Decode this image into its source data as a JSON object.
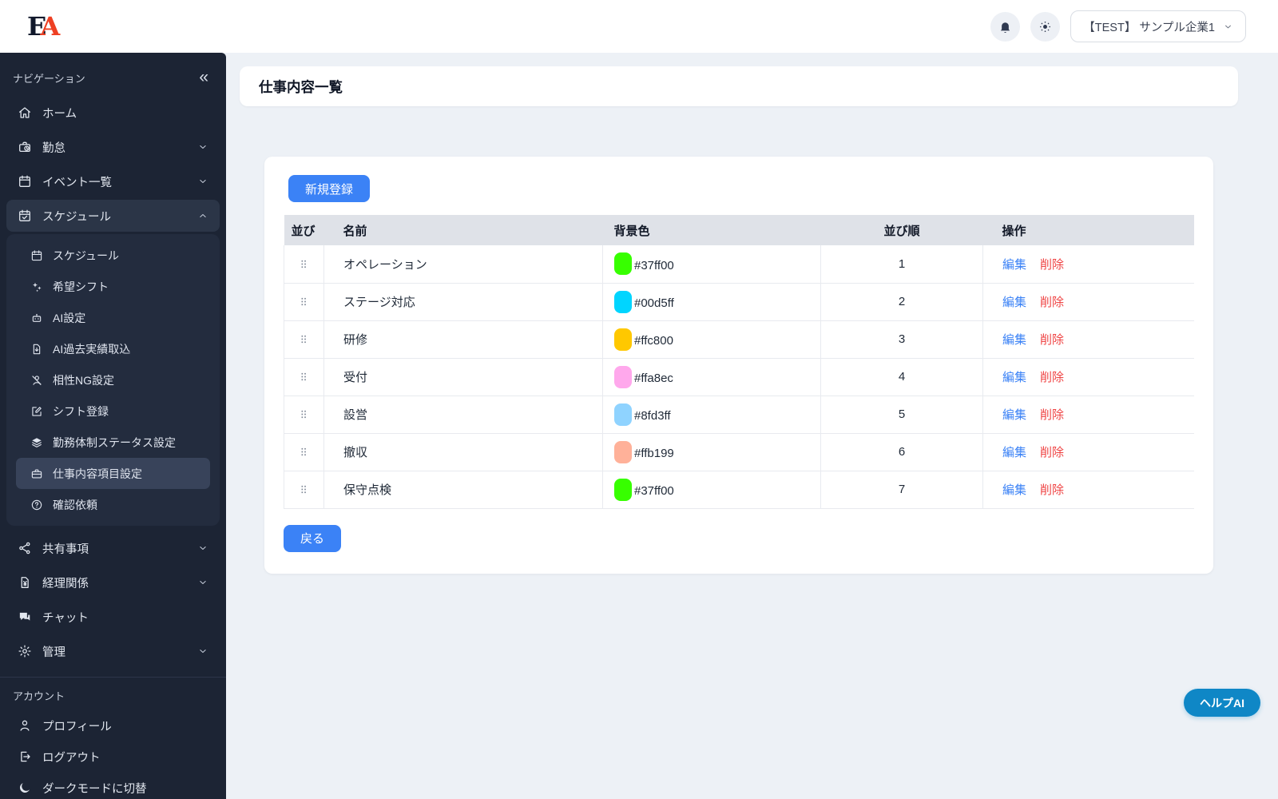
{
  "topbar": {
    "logo_text_e": "E",
    "logo_text_a": "A",
    "company_selector": "【TEST】 サンプル企業1"
  },
  "sidebar": {
    "header": "ナビゲーション",
    "collapse_glyph": "«",
    "items": [
      {
        "label": "ホーム",
        "icon": "home"
      },
      {
        "label": "勤怠",
        "icon": "briefcase-clock",
        "chevron": "down"
      },
      {
        "label": "イベント一覧",
        "icon": "calendar",
        "chevron": "down"
      },
      {
        "label": "スケジュール",
        "icon": "calendar-check",
        "chevron": "up",
        "active": true,
        "children": [
          {
            "label": "スケジュール",
            "icon": "calendar"
          },
          {
            "label": "希望シフト",
            "icon": "wand"
          },
          {
            "label": "AI設定",
            "icon": "robot"
          },
          {
            "label": "AI過去実績取込",
            "icon": "file-import"
          },
          {
            "label": "相性NG設定",
            "icon": "user-slash"
          },
          {
            "label": "シフト登録",
            "icon": "pen-square"
          },
          {
            "label": "勤務体制ステータス設定",
            "icon": "layers"
          },
          {
            "label": "仕事内容項目設定",
            "icon": "briefcase",
            "active": true
          },
          {
            "label": "確認依頼",
            "icon": "question-circle"
          }
        ]
      },
      {
        "label": "共有事項",
        "icon": "share",
        "chevron": "down"
      },
      {
        "label": "経理関係",
        "icon": "file-yen",
        "chevron": "down"
      },
      {
        "label": "チャット",
        "icon": "chat"
      },
      {
        "label": "管理",
        "icon": "gear",
        "chevron": "down"
      }
    ],
    "account_header": "アカウント",
    "account_items": [
      {
        "label": "プロフィール",
        "icon": "user"
      },
      {
        "label": "ログアウト",
        "icon": "logout"
      },
      {
        "label": "ダークモードに切替",
        "icon": "moon"
      }
    ]
  },
  "page": {
    "title": "仕事内容一覧"
  },
  "content": {
    "new_button_label": "新規登録",
    "back_button_label": "戻る",
    "help_button_label": "ヘルプAI",
    "table": {
      "headers": [
        "並び",
        "名前",
        "背景色",
        "並び順",
        "操作"
      ],
      "edit_label": "編集",
      "delete_label": "削除",
      "rows": [
        {
          "name": "オペレーション",
          "color": "#37ff00",
          "order": "1"
        },
        {
          "name": "ステージ対応",
          "color": "#00d5ff",
          "order": "2"
        },
        {
          "name": "研修",
          "color": "#ffc800",
          "order": "3"
        },
        {
          "name": "受付",
          "color": "#ffa8ec",
          "order": "4"
        },
        {
          "name": "設営",
          "color": "#8fd3ff",
          "order": "5"
        },
        {
          "name": "撤収",
          "color": "#ffb199",
          "order": "6"
        },
        {
          "name": "保守点検",
          "color": "#37ff00",
          "order": "7"
        }
      ]
    }
  },
  "colors": {
    "accent_blue": "#3b82f6",
    "edit_link": "#3b82f6",
    "delete_link": "#ef4444",
    "help_button": "#0f87c6",
    "sidebar_bg": "#1c2434",
    "table_header_bg": "#dfe2e8"
  }
}
